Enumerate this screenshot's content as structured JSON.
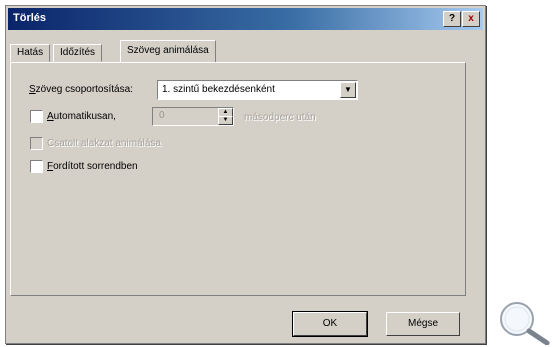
{
  "window": {
    "title": "Törlés",
    "help_label": "?",
    "close_label": "x"
  },
  "tabs": [
    {
      "label": "Hatás"
    },
    {
      "label": "Időzítés"
    },
    {
      "label": "Szöveg animálása"
    }
  ],
  "group_text": {
    "label_mnemonic": "S",
    "label_rest": "zöveg csoportosítása:",
    "selected_value": "1. szintű bekezdésenként"
  },
  "automatic": {
    "mnemonic": "A",
    "rest": "utomatikusan,",
    "value": "0",
    "suffix": "másodperc után",
    "checked": false
  },
  "animate_shape": {
    "label": "Csatolt alakzat animálása",
    "checked": false,
    "enabled": false
  },
  "reverse": {
    "mnemonic": "F",
    "rest": "ordított sorrendben",
    "checked": false
  },
  "buttons": {
    "ok": "OK",
    "cancel": "Mégse"
  },
  "icons": {
    "magnifier": "magnifier-icon"
  }
}
